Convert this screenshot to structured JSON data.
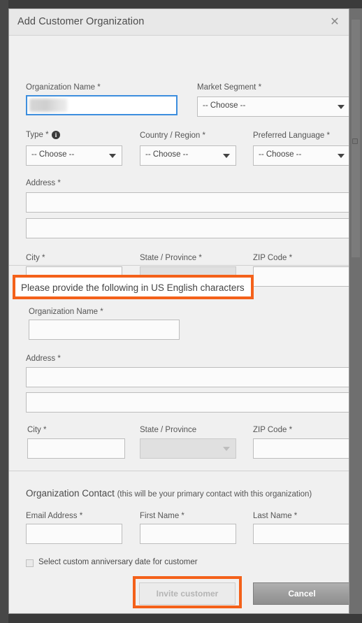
{
  "dialog": {
    "title": "Add Customer Organization",
    "close_icon": "close-icon",
    "close_glyph": "✕"
  },
  "accent_color": "#f4611a",
  "sections": {
    "primary": {
      "fields": {
        "org_name_label": "Organization Name *",
        "org_name_value": "",
        "market_segment_label": "Market Segment *",
        "market_segment_value": "-- Choose --",
        "type_label": "Type *",
        "type_info_glyph": "i",
        "type_value": "-- Choose --",
        "country_label": "Country / Region *",
        "country_value": "-- Choose --",
        "language_label": "Preferred Language *",
        "language_value": "-- Choose --",
        "address_label": "Address *",
        "address_line1_value": "",
        "address_line2_value": "",
        "city_label": "City *",
        "city_value": "",
        "state_label": "State / Province *",
        "state_value": "",
        "zip_label": "ZIP Code *",
        "zip_value": ""
      }
    },
    "english": {
      "notice": "Please provide the following in US English characters",
      "fields": {
        "org_name_label": "Organization Name *",
        "org_name_value": "",
        "address_label": "Address *",
        "address_line1_value": "",
        "address_line2_value": "",
        "city_label": "City *",
        "city_value": "",
        "state_label": "State / Province",
        "state_value": "",
        "zip_label": "ZIP Code *",
        "zip_value": ""
      }
    },
    "contact": {
      "heading": "Organization Contact",
      "heading_sub": "(this will be your primary contact with this organization)",
      "fields": {
        "email_label": "Email Address *",
        "email_value": "",
        "first_name_label": "First Name *",
        "first_name_value": "",
        "last_name_label": "Last Name *",
        "last_name_value": ""
      },
      "anniversary_checkbox_label": "Select custom anniversary date for customer",
      "anniversary_checked": false
    }
  },
  "footer": {
    "invite_label": "Invite customer",
    "invite_disabled": true,
    "cancel_label": "Cancel"
  }
}
